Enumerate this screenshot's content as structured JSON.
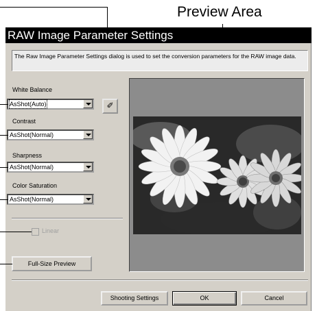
{
  "annotations": {
    "preview_area_label": "Preview Area"
  },
  "dialog": {
    "title": "RAW Image Parameter Settings",
    "description": "The Raw Image Parameter Settings dialog is used to set the conversion parameters for the RAW image data."
  },
  "white_balance": {
    "label": "White Balance",
    "value": "AsShot(Auto)"
  },
  "contrast": {
    "label": "Contrast",
    "value": "AsShot(Normal)"
  },
  "sharpness": {
    "label": "Sharpness",
    "value": "AsShot(Normal)"
  },
  "color_saturation": {
    "label": "Color Saturation",
    "value": "AsShot(Normal)"
  },
  "linear": {
    "label": "Linear",
    "checked": false,
    "enabled": false
  },
  "buttons": {
    "full_size_preview": "Full-Size Preview",
    "shooting_settings": "Shooting Settings",
    "ok": "OK",
    "cancel": "Cancel"
  },
  "icons": {
    "white_balance_picker": "eyedropper-icon",
    "dropdown": "chevron-down-icon"
  }
}
